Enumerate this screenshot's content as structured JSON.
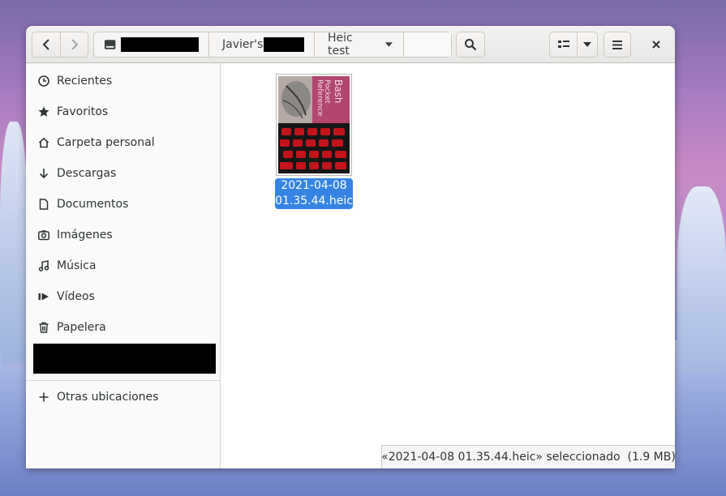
{
  "header": {
    "path": [
      "",
      "Javier's",
      "Heic test"
    ],
    "view_toggle_label": "",
    "buttons": {
      "back": "back",
      "forward": "forward",
      "search": "search",
      "view_list": "view-list",
      "view_options": "view-options",
      "menu": "menu",
      "close": "close"
    }
  },
  "sidebar": {
    "items": [
      {
        "label": "Recientes",
        "icon": "clock-icon"
      },
      {
        "label": "Favoritos",
        "icon": "star-icon"
      },
      {
        "label": "Carpeta personal",
        "icon": "home-icon"
      },
      {
        "label": "Descargas",
        "icon": "download-icon"
      },
      {
        "label": "Documentos",
        "icon": "document-icon"
      },
      {
        "label": "Imágenes",
        "icon": "camera-icon"
      },
      {
        "label": "Música",
        "icon": "music-icon"
      },
      {
        "label": "Vídeos",
        "icon": "video-icon"
      },
      {
        "label": "Papelera",
        "icon": "trash-icon"
      }
    ],
    "other_locations": "Otras ubicaciones"
  },
  "files": [
    {
      "name_line1": "2021-04-08",
      "name_line2": "01.35.44.heic",
      "selected": true
    }
  ],
  "status": {
    "text": "«2021-04-08 01.35.44.heic» seleccionado  (1.9 MB)"
  },
  "colors": {
    "accent": "#3584e4",
    "headerbar": "#e8e8e7",
    "sidebar": "#fafafa"
  }
}
